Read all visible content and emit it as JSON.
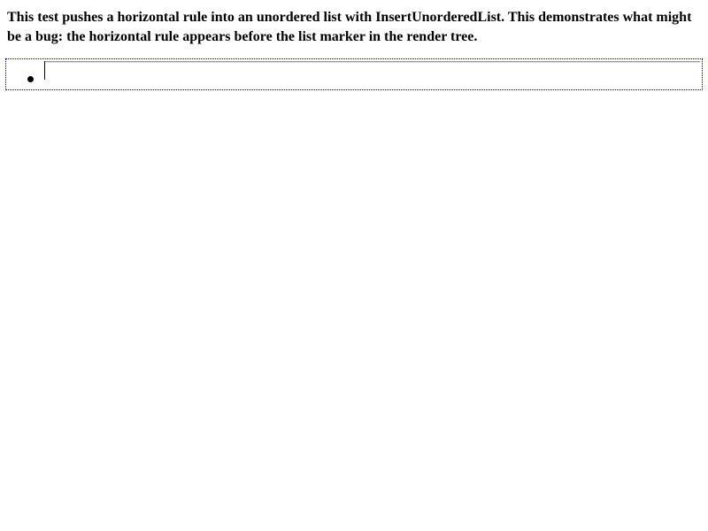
{
  "description": "This test pushes a horizontal rule into an unordered list with InsertUnorderedList. This demonstrates what might be a bug: the horizontal rule appears before the list marker in the render tree.",
  "editor": {
    "border_color": "#00008b",
    "list_marker": "disc",
    "contains": [
      "horizontal-rule",
      "caret"
    ]
  }
}
